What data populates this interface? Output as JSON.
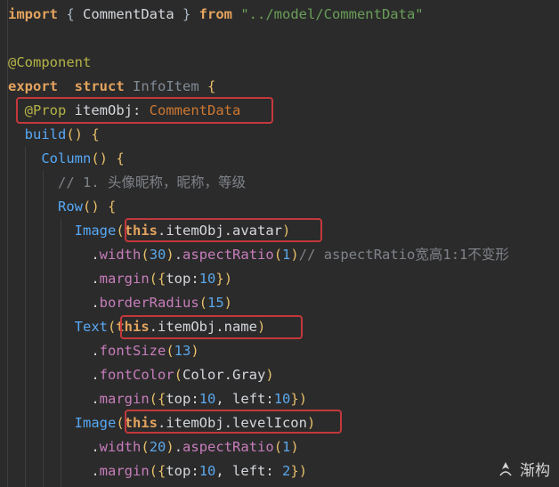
{
  "lines": [
    [
      {
        "t": "import",
        "c": "kw"
      },
      {
        "t": " { ",
        "c": "punct"
      },
      {
        "t": "CommentData",
        "c": "plain"
      },
      {
        "t": " } ",
        "c": "punct"
      },
      {
        "t": "from",
        "c": "kw"
      },
      {
        "t": " ",
        "c": "plain"
      },
      {
        "t": "\"../model/CommentData\"",
        "c": "str"
      }
    ],
    [],
    [
      {
        "t": "@Component",
        "c": "ann"
      }
    ],
    [
      {
        "t": "export",
        "c": "kw"
      },
      {
        "t": "  ",
        "c": "plain"
      },
      {
        "t": "struct",
        "c": "kw"
      },
      {
        "t": " ",
        "c": "plain"
      },
      {
        "t": "InfoItem",
        "c": "cls"
      },
      {
        "t": " {",
        "c": "brace"
      }
    ],
    [
      {
        "t": "  ",
        "c": "plain"
      },
      {
        "t": "@Prop",
        "c": "ann"
      },
      {
        "t": " itemObj: ",
        "c": "plain"
      },
      {
        "t": "CommentData",
        "c": "type"
      }
    ],
    [
      {
        "t": "  ",
        "c": "plain"
      },
      {
        "t": "build",
        "c": "func"
      },
      {
        "t": "() {",
        "c": "brace"
      }
    ],
    [
      {
        "t": "    ",
        "c": "plain"
      },
      {
        "t": "Column",
        "c": "func"
      },
      {
        "t": "() {",
        "c": "brace"
      }
    ],
    [
      {
        "t": "      ",
        "c": "plain"
      },
      {
        "t": "// 1. 头像昵称，昵称，等级",
        "c": "cmt"
      }
    ],
    [
      {
        "t": "      ",
        "c": "plain"
      },
      {
        "t": "Row",
        "c": "func"
      },
      {
        "t": "() {",
        "c": "brace"
      }
    ],
    [
      {
        "t": "        ",
        "c": "plain"
      },
      {
        "t": "Image",
        "c": "func"
      },
      {
        "t": "(",
        "c": "brace"
      },
      {
        "t": "this",
        "c": "kwt"
      },
      {
        "t": ".itemObj.avatar",
        "c": "plain"
      },
      {
        "t": ")",
        "c": "brace"
      }
    ],
    [
      {
        "t": "          ",
        "c": "plain"
      },
      {
        "t": ".",
        "c": "plain"
      },
      {
        "t": "width",
        "c": "prop"
      },
      {
        "t": "(",
        "c": "brace"
      },
      {
        "t": "30",
        "c": "num"
      },
      {
        "t": ")",
        "c": "brace"
      },
      {
        "t": ".",
        "c": "plain"
      },
      {
        "t": "aspectRatio",
        "c": "prop"
      },
      {
        "t": "(",
        "c": "brace"
      },
      {
        "t": "1",
        "c": "num"
      },
      {
        "t": ")",
        "c": "brace"
      },
      {
        "t": "// aspectRatio宽高1:1不变形",
        "c": "cmt"
      }
    ],
    [
      {
        "t": "          ",
        "c": "plain"
      },
      {
        "t": ".",
        "c": "plain"
      },
      {
        "t": "margin",
        "c": "prop"
      },
      {
        "t": "({",
        "c": "brace"
      },
      {
        "t": "top",
        "c": "plain"
      },
      {
        "t": ":",
        "c": "plain"
      },
      {
        "t": "10",
        "c": "num"
      },
      {
        "t": "})",
        "c": "brace"
      }
    ],
    [
      {
        "t": "          ",
        "c": "plain"
      },
      {
        "t": ".",
        "c": "plain"
      },
      {
        "t": "borderRadius",
        "c": "prop"
      },
      {
        "t": "(",
        "c": "brace"
      },
      {
        "t": "15",
        "c": "num"
      },
      {
        "t": ")",
        "c": "brace"
      }
    ],
    [
      {
        "t": "        ",
        "c": "plain"
      },
      {
        "t": "Text",
        "c": "func"
      },
      {
        "t": "(",
        "c": "brace"
      },
      {
        "t": "this",
        "c": "kwt"
      },
      {
        "t": ".itemObj.name",
        "c": "plain"
      },
      {
        "t": ")",
        "c": "brace"
      }
    ],
    [
      {
        "t": "          ",
        "c": "plain"
      },
      {
        "t": ".",
        "c": "plain"
      },
      {
        "t": "fontSize",
        "c": "prop"
      },
      {
        "t": "(",
        "c": "brace"
      },
      {
        "t": "13",
        "c": "num"
      },
      {
        "t": ")",
        "c": "brace"
      }
    ],
    [
      {
        "t": "          ",
        "c": "plain"
      },
      {
        "t": ".",
        "c": "plain"
      },
      {
        "t": "fontColor",
        "c": "prop"
      },
      {
        "t": "(",
        "c": "brace"
      },
      {
        "t": "Color.Gray",
        "c": "plain"
      },
      {
        "t": ")",
        "c": "brace"
      }
    ],
    [
      {
        "t": "          ",
        "c": "plain"
      },
      {
        "t": ".",
        "c": "plain"
      },
      {
        "t": "margin",
        "c": "prop"
      },
      {
        "t": "({",
        "c": "brace"
      },
      {
        "t": "top",
        "c": "plain"
      },
      {
        "t": ":",
        "c": "plain"
      },
      {
        "t": "10",
        "c": "num"
      },
      {
        "t": ", ",
        "c": "plain"
      },
      {
        "t": "left",
        "c": "plain"
      },
      {
        "t": ":",
        "c": "plain"
      },
      {
        "t": "10",
        "c": "num"
      },
      {
        "t": "})",
        "c": "brace"
      }
    ],
    [
      {
        "t": "        ",
        "c": "plain"
      },
      {
        "t": "Image",
        "c": "func"
      },
      {
        "t": "(",
        "c": "brace"
      },
      {
        "t": "this",
        "c": "kwt"
      },
      {
        "t": ".itemObj.levelIcon",
        "c": "plain"
      },
      {
        "t": ")",
        "c": "brace"
      }
    ],
    [
      {
        "t": "          ",
        "c": "plain"
      },
      {
        "t": ".",
        "c": "plain"
      },
      {
        "t": "width",
        "c": "prop"
      },
      {
        "t": "(",
        "c": "brace"
      },
      {
        "t": "20",
        "c": "num"
      },
      {
        "t": ")",
        "c": "brace"
      },
      {
        "t": ".",
        "c": "plain"
      },
      {
        "t": "aspectRatio",
        "c": "prop"
      },
      {
        "t": "(",
        "c": "brace"
      },
      {
        "t": "1",
        "c": "num"
      },
      {
        "t": ")",
        "c": "brace"
      }
    ],
    [
      {
        "t": "          ",
        "c": "plain"
      },
      {
        "t": ".",
        "c": "plain"
      },
      {
        "t": "margin",
        "c": "prop"
      },
      {
        "t": "({",
        "c": "brace"
      },
      {
        "t": "top",
        "c": "plain"
      },
      {
        "t": ":",
        "c": "plain"
      },
      {
        "t": "10",
        "c": "num"
      },
      {
        "t": ", ",
        "c": "plain"
      },
      {
        "t": "left",
        "c": "plain"
      },
      {
        "t": ": ",
        "c": "plain"
      },
      {
        "t": "2",
        "c": "num"
      },
      {
        "t": "})",
        "c": "brace"
      }
    ]
  ],
  "colors": {
    "background": "#2b2b2b",
    "highlight_box": "#c4383c"
  },
  "watermark": {
    "icon": "watermark-logo-icon",
    "text": "渐构"
  }
}
